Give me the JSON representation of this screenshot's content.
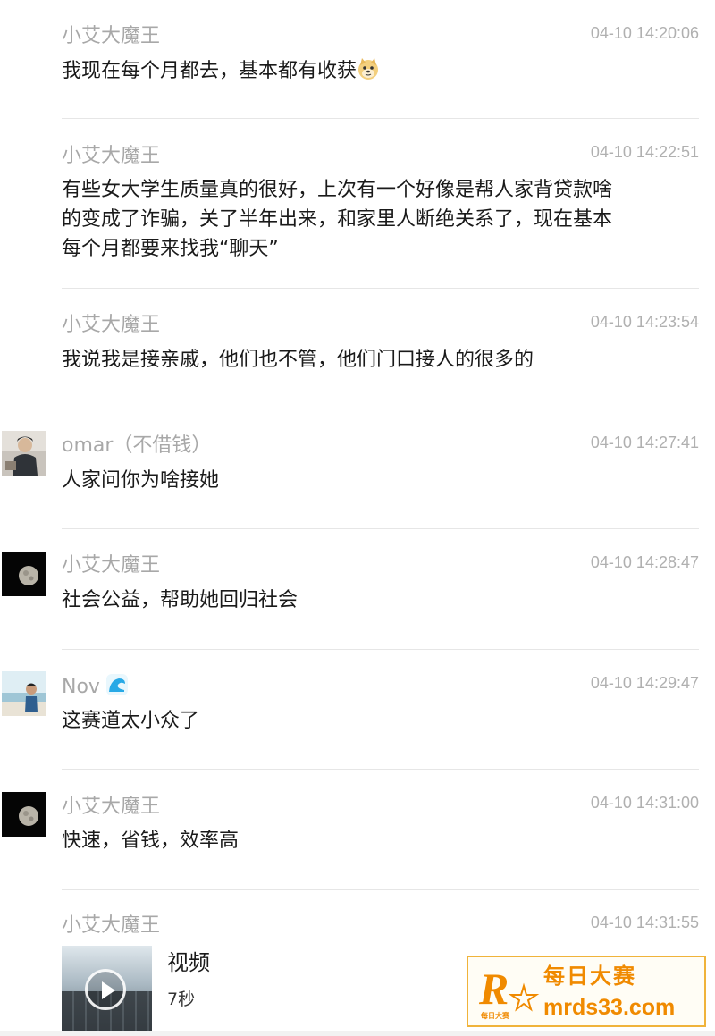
{
  "messages": [
    {
      "sender": "小艾大魔王",
      "time": "04-10 14:20:06",
      "text": "我现在每个月都去，基本都有收获",
      "avatar": "none",
      "emoji": "doge-emoji-icon"
    },
    {
      "sender": "小艾大魔王",
      "time": "04-10 14:22:51",
      "lines": [
        "有些女大学生质量真的很好，上次有一个好像是帮人家背贷款啥",
        "的变成了诈骗，关了半年出来，和家里人断绝关系了，现在基本",
        "每个月都要来找我“聊天”"
      ],
      "avatar": "none"
    },
    {
      "sender": "小艾大魔王",
      "time": "04-10 14:23:54",
      "text": "我说我是接亲戚，他们也不管，他们门口接人的很多的",
      "avatar": "none"
    },
    {
      "sender": "omar（不借钱）",
      "time": "04-10 14:27:41",
      "text": "人家问你为啥接她",
      "avatar": "man-photo"
    },
    {
      "sender": "小艾大魔王",
      "time": "04-10 14:28:47",
      "text": "社会公益，帮助她回归社会",
      "avatar": "moon-photo"
    },
    {
      "sender": "Nov",
      "time": "04-10 14:29:47",
      "text": "这赛道太小众了",
      "avatar": "beach-photo",
      "badge": "wave-icon"
    },
    {
      "sender": "小艾大魔王",
      "time": "04-10 14:31:00",
      "text": "快速，省钱，效率高",
      "avatar": "moon-photo"
    },
    {
      "sender": "小艾大魔王",
      "time": "04-10 14:31:55",
      "avatar": "none",
      "video": {
        "title": "视频",
        "duration": "7秒"
      }
    }
  ],
  "watermark": {
    "name": "每日大赛",
    "site": "mrds33.com",
    "logo_letter": "R",
    "logo_small": "每日大赛",
    "accent": "#f08a00",
    "border": "#f0b33a"
  },
  "colors": {
    "sender": "#a8a8a8",
    "time": "#b0b0b0",
    "divider": "#e6e6e6"
  }
}
